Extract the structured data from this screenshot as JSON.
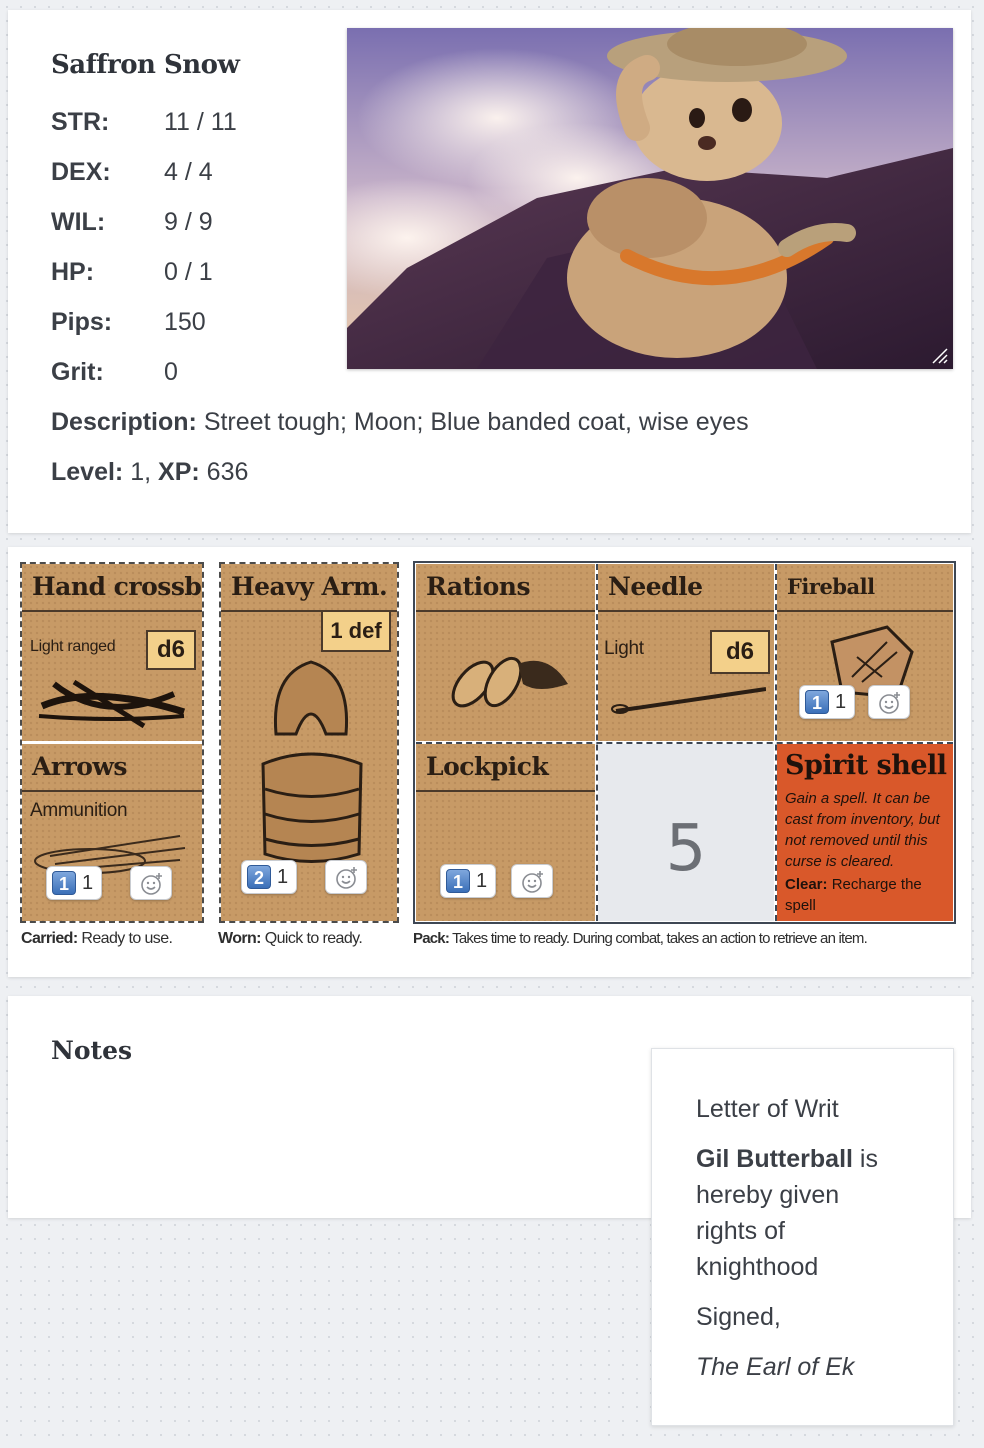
{
  "character": {
    "name": "Saffron Snow",
    "stats": [
      {
        "label": "STR:",
        "value": "11 / 11"
      },
      {
        "label": "DEX:",
        "value": "4 / 4"
      },
      {
        "label": "WIL:",
        "value": "9 / 9"
      },
      {
        "label": "HP:",
        "value": "0 / 1"
      },
      {
        "label": "Pips:",
        "value": "150"
      },
      {
        "label": "Grit:",
        "value": "0"
      }
    ],
    "description_label": "Description:",
    "description": "Street tough; Moon; Blue banded coat, wise eyes",
    "level_label": "Level:",
    "level": "1",
    "xp_label": "XP:",
    "xp": "636"
  },
  "inventory": {
    "hand_crossbow": {
      "title": "Hand crossbow",
      "sub": "Light ranged",
      "tag": "d6"
    },
    "arrows": {
      "title": "Arrows",
      "sub": "Ammunition",
      "usage": "1",
      "count": "1"
    },
    "heavy_armor": {
      "title": "Heavy Arm.",
      "tag": "1 def",
      "usage": "2",
      "count": "1"
    },
    "rations": {
      "title": "Rations"
    },
    "needle": {
      "title": "Needle",
      "sub": "Light",
      "tag": "d6"
    },
    "fireball": {
      "title": "Fireball",
      "usage": "1",
      "count": "1"
    },
    "lockpick": {
      "title": "Lockpick",
      "usage": "1",
      "count": "1"
    },
    "empty_slot": {
      "number": "5"
    },
    "spirit_shell": {
      "title": "Spirit shell",
      "text": "Gain a spell. It can be cast from inventory, but not removed until this curse is cleared.",
      "clear_label": "Clear:",
      "clear_text": "Recharge the spell"
    },
    "captions": {
      "carried_label": "Carried:",
      "carried_text": "Ready to use.",
      "worn_label": "Worn:",
      "worn_text": "Quick to ready.",
      "pack_label": "Pack:",
      "pack_text": "Takes time to ready. During combat, takes an action to retrieve an item."
    }
  },
  "notes": {
    "title": "Notes"
  },
  "letter": {
    "heading": "Letter of Writ",
    "name": "Gil Butterball",
    "line1": "is",
    "line2": "hereby given",
    "line3": "rights of",
    "line4": "knighthood",
    "signed": "Signed,",
    "signature": "The Earl of Ek"
  },
  "colors": {
    "parchment": "#c79a66",
    "spirit_shell": "#d9582a",
    "empty_slot": "#e7e9ed",
    "usage_badge": "#3a6fb8"
  }
}
